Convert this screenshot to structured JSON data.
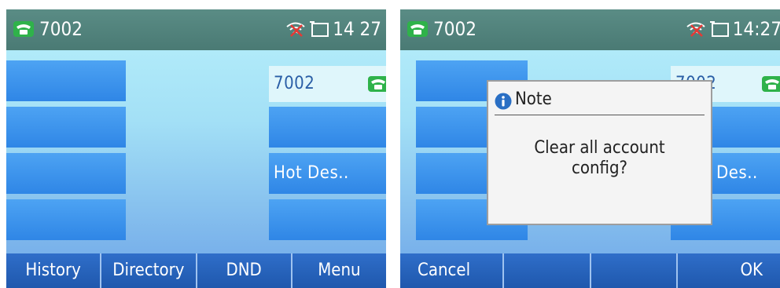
{
  "left_screen": {
    "status": {
      "extension": "7002",
      "time": "14 27"
    },
    "line_keys_right": [
      {
        "label": "7002"
      },
      {
        "label": ""
      },
      {
        "label": "Hot Des.."
      },
      {
        "label": ""
      }
    ],
    "softkeys": [
      {
        "label": "History"
      },
      {
        "label": "Directory"
      },
      {
        "label": "DND"
      },
      {
        "label": "Menu"
      }
    ]
  },
  "right_screen": {
    "status": {
      "extension": "7002",
      "time": "14:27"
    },
    "line_keys_right": [
      {
        "label": "7002"
      },
      {
        "label": ""
      },
      {
        "label": "Des.."
      },
      {
        "label": ""
      }
    ],
    "dialog": {
      "title": "Note",
      "message_line1": "Clear all account",
      "message_line2": "config?"
    },
    "softkeys": [
      {
        "label": "Cancel"
      },
      {
        "label": ""
      },
      {
        "label": ""
      },
      {
        "label": "OK"
      }
    ]
  },
  "colors": {
    "status_bar": "#4a7a74",
    "line_key": "#2f86e6",
    "account_key": "#dff6fb",
    "softkey_bar": "#1f58ad",
    "phone_icon_green": "#2fb24a",
    "info_icon": "#2a6fc4"
  }
}
